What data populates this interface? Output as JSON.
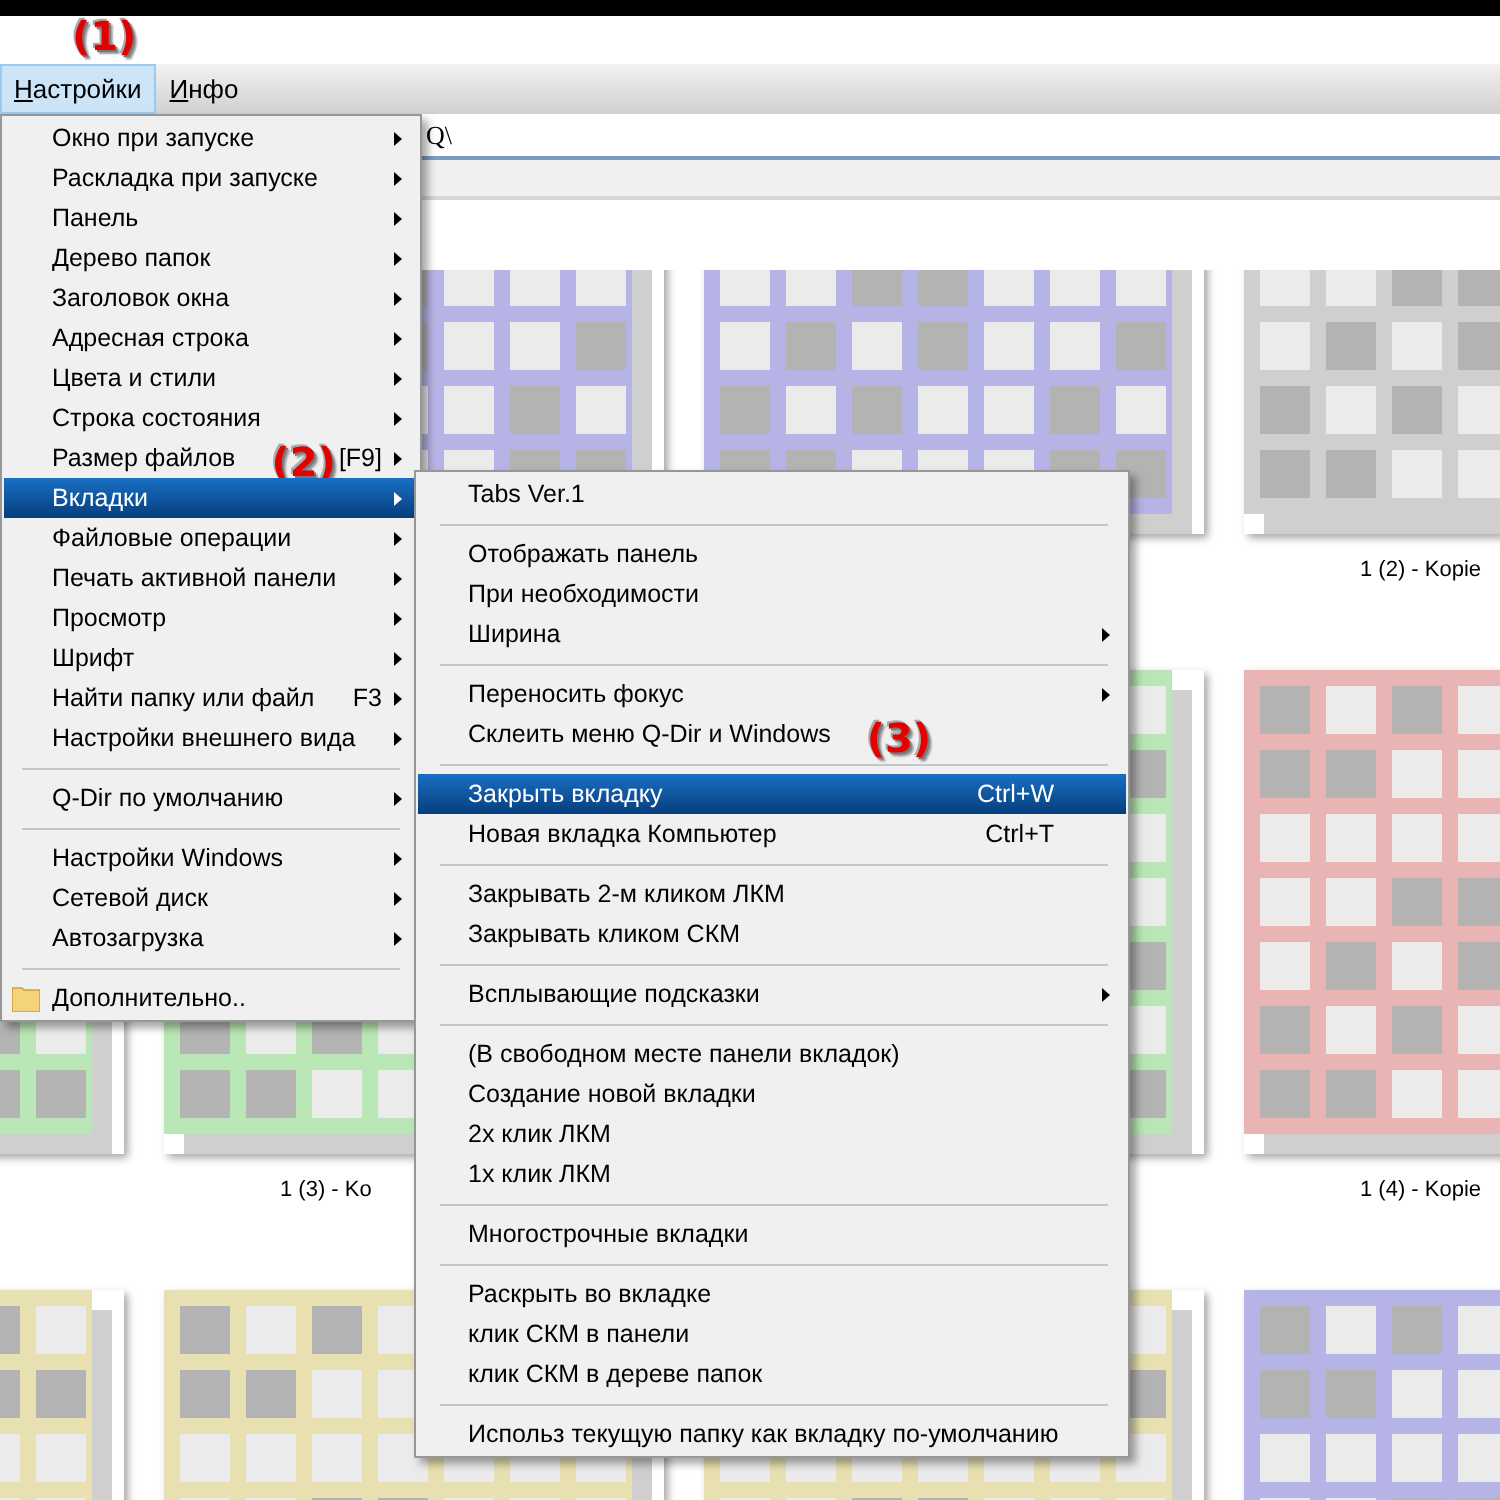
{
  "menubar": [
    {
      "label": "Настройки",
      "selected": true,
      "annotation": "(1)"
    },
    {
      "label": "Инфо",
      "selected": false
    }
  ],
  "address_bar": {
    "value": "Q\\"
  },
  "file_rows": [
    {
      "files": [
        {
          "color": "#b6b4e6"
        },
        {
          "color": "#b6b4e6"
        },
        {
          "color": "#cfcfcf",
          "label": "1 (2) - Kopie"
        }
      ]
    },
    {
      "files": [
        {
          "color": "#b8e6b4"
        },
        {
          "color": "#b8e6b4",
          "label": "1 (3) - Ko"
        },
        {
          "color": "#b8e6b4"
        },
        {
          "color": "#e8b4b4",
          "label": "1 (4) - Kopie"
        }
      ]
    },
    {
      "files": [
        {
          "color": "#e8e0b0"
        },
        {
          "color": "#e8e0b0"
        },
        {
          "color": "#e8e0b0"
        },
        {
          "color": "#b6b4e6"
        }
      ]
    }
  ],
  "menu": {
    "items": [
      {
        "kind": "item",
        "label": "Окно при запуске",
        "submenu": true,
        "selected": false
      },
      {
        "kind": "item",
        "label": "Раскладка при запуске",
        "submenu": true,
        "selected": false
      },
      {
        "kind": "item",
        "label": "Панель",
        "submenu": true,
        "selected": false
      },
      {
        "kind": "item",
        "label": "Дерево папок",
        "submenu": true,
        "selected": false
      },
      {
        "kind": "item",
        "label": "Заголовок окна",
        "submenu": true,
        "selected": false
      },
      {
        "kind": "item",
        "label": "Адресная строка",
        "submenu": true,
        "selected": false
      },
      {
        "kind": "item",
        "label": "Цвета и стили",
        "submenu": true,
        "selected": false
      },
      {
        "kind": "item",
        "label": "Строка состояния",
        "submenu": true,
        "selected": false
      },
      {
        "kind": "item",
        "label": "Размер файлов",
        "annotation": "(2)",
        "shortcut": "[F9]",
        "submenu": true,
        "selected": false
      },
      {
        "kind": "item",
        "label": "Вкладки",
        "submenu": true,
        "selected": true
      },
      {
        "kind": "item",
        "label": "Файловые операции",
        "submenu": true,
        "selected": false
      },
      {
        "kind": "item",
        "label": "Печать активной панели",
        "submenu": true,
        "selected": false
      },
      {
        "kind": "item",
        "label": "Просмотр",
        "submenu": true,
        "selected": false
      },
      {
        "kind": "item",
        "label": "Шрифт",
        "submenu": true,
        "selected": false
      },
      {
        "kind": "item",
        "label": "Найти папку или файл",
        "shortcut": "F3",
        "submenu": true,
        "selected": false
      },
      {
        "kind": "item",
        "label": "Настройки внешнего вида",
        "submenu": true,
        "selected": false
      },
      {
        "kind": "separator"
      },
      {
        "kind": "item",
        "label": "Q-Dir по умолчанию",
        "submenu": true,
        "selected": false
      },
      {
        "kind": "separator"
      },
      {
        "kind": "item",
        "label": "Настройки Windows",
        "submenu": true,
        "selected": false
      },
      {
        "kind": "item",
        "label": "Сетевой диск",
        "submenu": true,
        "selected": false
      },
      {
        "kind": "item",
        "label": "Автозагрузка",
        "submenu": true,
        "selected": false
      },
      {
        "kind": "separator"
      },
      {
        "kind": "folder-item",
        "label": "Дополнительно..",
        "submenu": false,
        "selected": false
      }
    ]
  },
  "submenu": {
    "items": [
      {
        "kind": "item",
        "label": "Tabs Ver.1",
        "submenu": false,
        "selected": false
      },
      {
        "kind": "separator"
      },
      {
        "kind": "item",
        "label": "Отображать панель",
        "submenu": false,
        "selected": false
      },
      {
        "kind": "item",
        "label": "При необходимости",
        "submenu": false,
        "selected": false
      },
      {
        "kind": "item",
        "label": "Ширина",
        "submenu": true,
        "selected": false
      },
      {
        "kind": "separator"
      },
      {
        "kind": "item",
        "label": "Переносить фокус",
        "submenu": true,
        "selected": false
      },
      {
        "kind": "item",
        "label": "Склеить меню Q-Dir и Windows",
        "annotation": "(3)",
        "submenu": false,
        "selected": false
      },
      {
        "kind": "separator"
      },
      {
        "kind": "item",
        "label": "Закрыть вкладку",
        "shortcut": "Ctrl+W",
        "submenu": false,
        "selected": true
      },
      {
        "kind": "item",
        "label": "Новая вкладка Компьютер",
        "shortcut": "Ctrl+T",
        "submenu": false,
        "selected": false
      },
      {
        "kind": "separator"
      },
      {
        "kind": "item",
        "label": "Закрывать 2-м кликом ЛКМ",
        "submenu": false,
        "selected": false
      },
      {
        "kind": "item",
        "label": "Закрывать кликом СКМ",
        "submenu": false,
        "selected": false
      },
      {
        "kind": "separator"
      },
      {
        "kind": "item",
        "label": "Всплывающие подсказки",
        "submenu": true,
        "selected": false
      },
      {
        "kind": "separator"
      },
      {
        "kind": "item",
        "label": "(В свободном месте панели вкладок)",
        "submenu": false,
        "selected": false
      },
      {
        "kind": "item",
        "label": "Создание новой вкладки",
        "submenu": false,
        "selected": false
      },
      {
        "kind": "item",
        "label": "2x клик ЛКМ",
        "submenu": false,
        "selected": false
      },
      {
        "kind": "item",
        "label": "1x клик ЛКМ",
        "submenu": false,
        "selected": false
      },
      {
        "kind": "separator"
      },
      {
        "kind": "item",
        "label": "Многострочные вкладки",
        "submenu": false,
        "selected": false
      },
      {
        "kind": "separator"
      },
      {
        "kind": "item",
        "label": "Раскрыть во вкладке",
        "submenu": false,
        "selected": false
      },
      {
        "kind": "item",
        "label": "клик СКМ в панели",
        "submenu": false,
        "selected": false
      },
      {
        "kind": "item",
        "label": "клик СКМ в дереве папок",
        "submenu": false,
        "selected": false
      },
      {
        "kind": "separator"
      },
      {
        "kind": "item",
        "label": "Использ текущую папку как вкладку по-умолчанию",
        "submenu": false,
        "selected": false
      }
    ]
  }
}
